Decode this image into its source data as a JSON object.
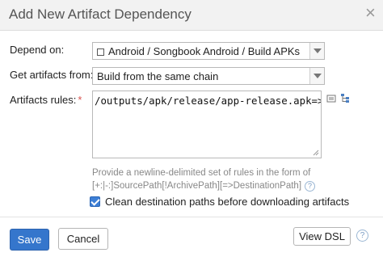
{
  "dialog": {
    "title": "Add New Artifact Dependency",
    "close_icon": "close-icon"
  },
  "form": {
    "depend_on": {
      "label": "Depend on:",
      "value": "Android / Songbook Android / Build APKs"
    },
    "get_artifacts_from": {
      "label": "Get artifacts from:",
      "value": "Build from the same chain"
    },
    "artifacts_rules": {
      "label": "Artifacts rules:",
      "required_mark": "*",
      "value": "/outputs/apk/release/app-release.apk=>app"
    },
    "help_line1": "Provide a newline-delimited set of rules in the form of",
    "help_line2": "[+:|-:]SourcePath[!ArchivePath][=>DestinationPath]",
    "clean_destination": {
      "label": "Clean destination paths before downloading artifacts",
      "checked": true
    }
  },
  "footer": {
    "save_label": "Save",
    "cancel_label": "Cancel",
    "view_dsl_label": "View DSL"
  },
  "colors": {
    "accent": "#3576cc",
    "required": "#d9534f"
  }
}
